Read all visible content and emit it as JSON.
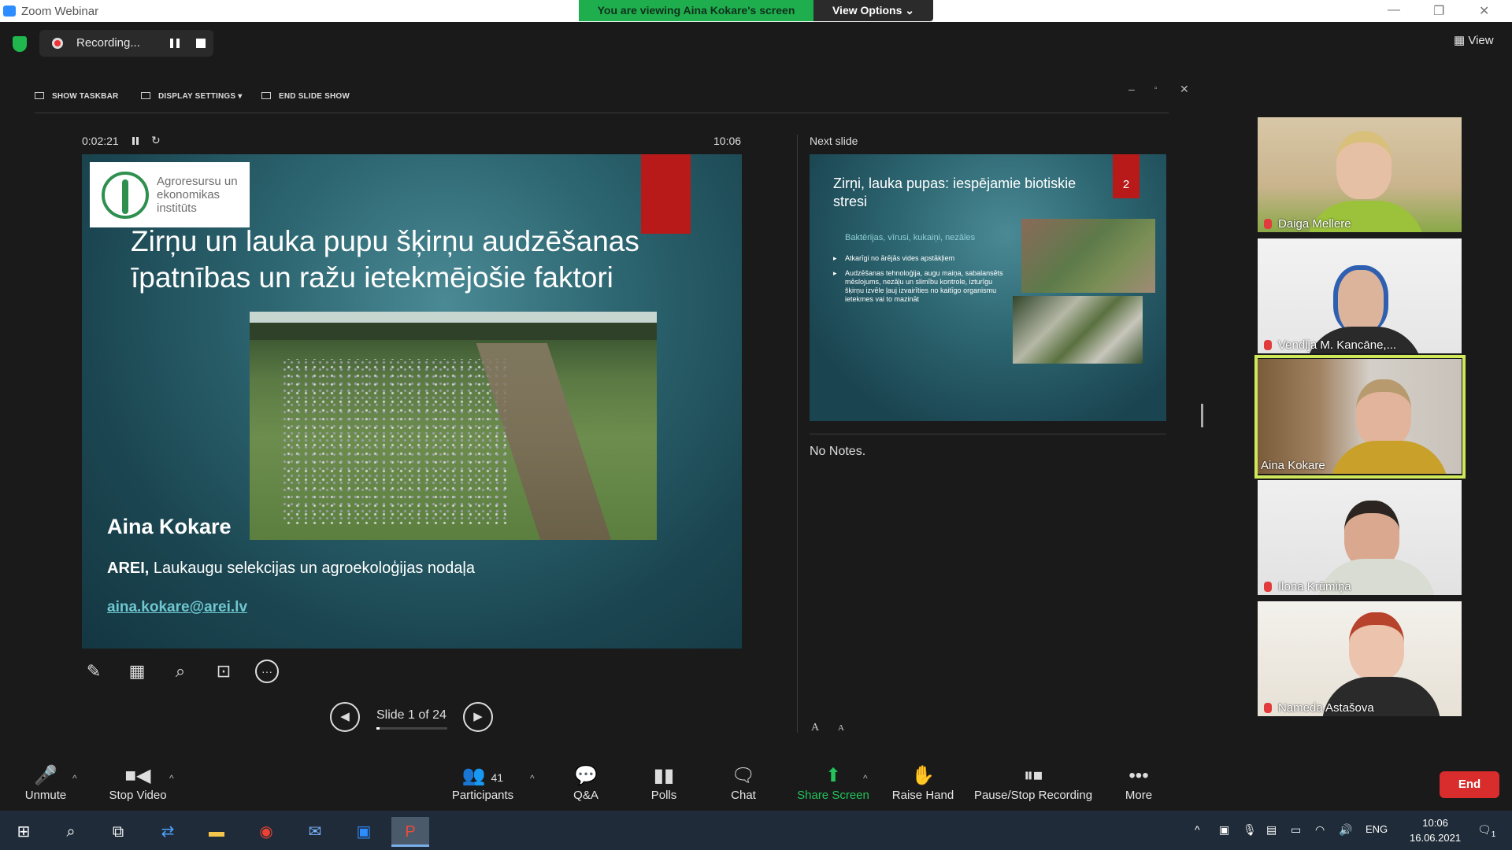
{
  "window": {
    "app_title": "Zoom Webinar",
    "viewing_banner": "You are viewing Aina Kokare's screen",
    "view_options": "View Options ⌄",
    "minimize": "—",
    "restore": "❐",
    "close": "✕"
  },
  "top_bar": {
    "recording_label": "Recording...",
    "view_label": "▦ View"
  },
  "ppt": {
    "toolbar": {
      "show_taskbar": "SHOW TASKBAR",
      "display_settings": "DISPLAY SETTINGS ▾",
      "end_slide_show": "END SLIDE SHOW"
    },
    "window_controls": {
      "min": "–",
      "max": "▫",
      "close": "✕"
    },
    "timer": "0:02:21",
    "timer_reset": "↻",
    "clock": "10:06",
    "current_slide": {
      "logo_text": "Agroresursu un ekonomikas institūts",
      "title": "Zirņu un lauka pupu šķirņu audzēšanas īpatnības un ražu ietekmējošie faktori",
      "presenter_name": "Aina Kokare",
      "affiliation_bold": "AREI,",
      "affiliation_rest": " Laukaugu selekcijas un agroekoloģijas nodaļa",
      "email": " aina.kokare@arei.lv"
    },
    "tools": {
      "pen": "✎",
      "grid": "▦",
      "zoom": "⌕",
      "pointer": "⊡",
      "more": "···"
    },
    "nav": {
      "prev": "◀",
      "next": "▶",
      "counter": "Slide 1 of 24",
      "progress": 0.04
    },
    "next_slide_label": "Next slide",
    "next_slide": {
      "title": "Zirņi, lauka pupas: iespējamie biotiskie stresi",
      "number": "2",
      "subtitle": "Baktērijas, vīrusi, kukaiņi, nezāles",
      "bullets": [
        "Atkarīgi no ārējās vides apstākļiem",
        "Audzēšanas tehnoloģija, augu maiņa, sabalansēts mēslojums, nezāļu un slimību kontrole, izturīgu šķirņu izvēle ļauj izvairīties no kaitīgo organismu ietekmes vai to mazināt"
      ]
    },
    "notes": "No Notes.",
    "font_increase": "A",
    "font_decrease": "A"
  },
  "participants": [
    {
      "name": "Daiga Mellere",
      "muted": true
    },
    {
      "name": "Vendija M. Kancāne,...",
      "muted": true
    },
    {
      "name": "Aina Kokare",
      "muted": false,
      "active": true
    },
    {
      "name": "Ilona Krūmiņa",
      "muted": true
    },
    {
      "name": "Nameda Astašova",
      "muted": true
    }
  ],
  "controls": {
    "unmute": "Unmute",
    "stop_video": "Stop Video",
    "participants_count": "41",
    "participants": "Participants",
    "qa": "Q&A",
    "polls": "Polls",
    "chat": "Chat",
    "share_screen": "Share Screen",
    "raise_hand": "Raise Hand",
    "pause_stop_recording": "Pause/Stop Recording",
    "more": "More",
    "end": "End"
  },
  "taskbar": {
    "language": "ENG",
    "time": "10:06",
    "date": "16.06.2021",
    "notification_count": "1"
  },
  "colors": {
    "zoom_green": "#1fae4e",
    "end_red": "#d92d2d",
    "active_speaker_border": "#cfe85a",
    "slide_red": "#b81a1a"
  }
}
